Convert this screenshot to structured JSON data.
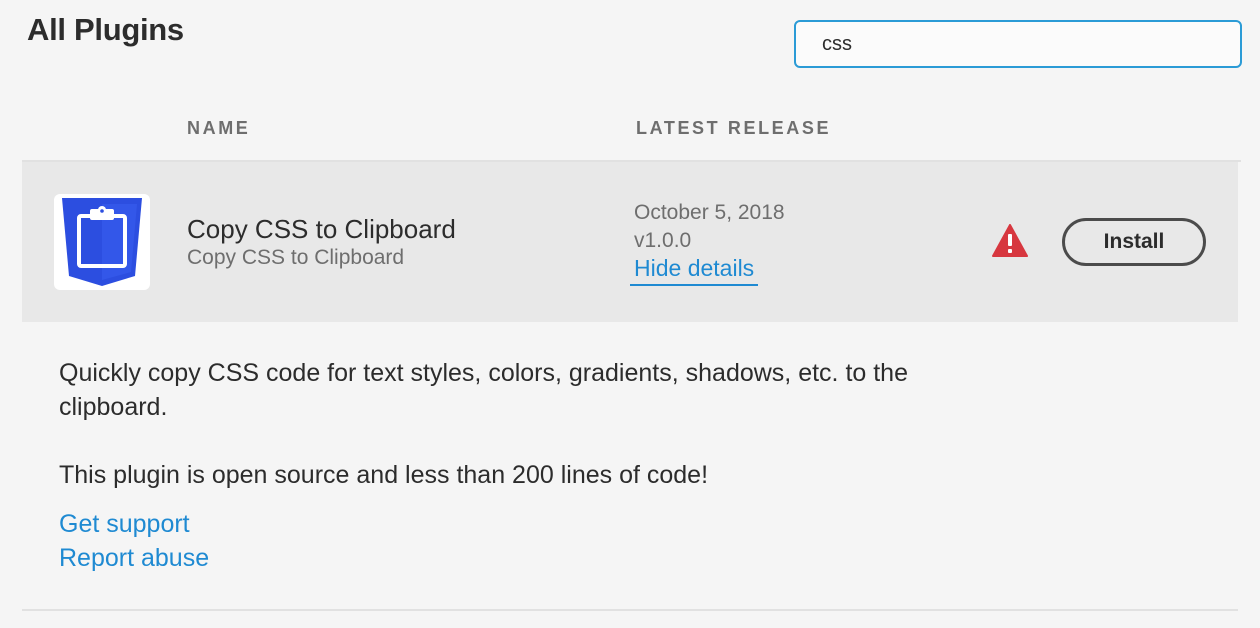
{
  "header": {
    "title": "All Plugins",
    "search_value": "css"
  },
  "table": {
    "columns": [
      "NAME",
      "LATEST RELEASE"
    ]
  },
  "plugin": {
    "name": "Copy CSS to Clipboard",
    "subtitle": "Copy CSS to Clipboard",
    "release_date": "October 5, 2018",
    "version": "v1.0.0",
    "details_toggle_label": "Hide details",
    "install_label": "Install",
    "icon": "css-clipboard-icon",
    "status_icon": "warning-icon",
    "description": "Quickly copy CSS code for text styles, colors, gradients, shadows, etc. to the clipboard.",
    "description_2": "This plugin is open source and less than 200 lines of code!",
    "links": {
      "support": "Get support",
      "abuse": "Report abuse"
    }
  },
  "colors": {
    "accent": "#2b9bd6",
    "link": "#1f8ad2",
    "icon_blue": "#2c4ee0",
    "warning": "#d7373f"
  }
}
